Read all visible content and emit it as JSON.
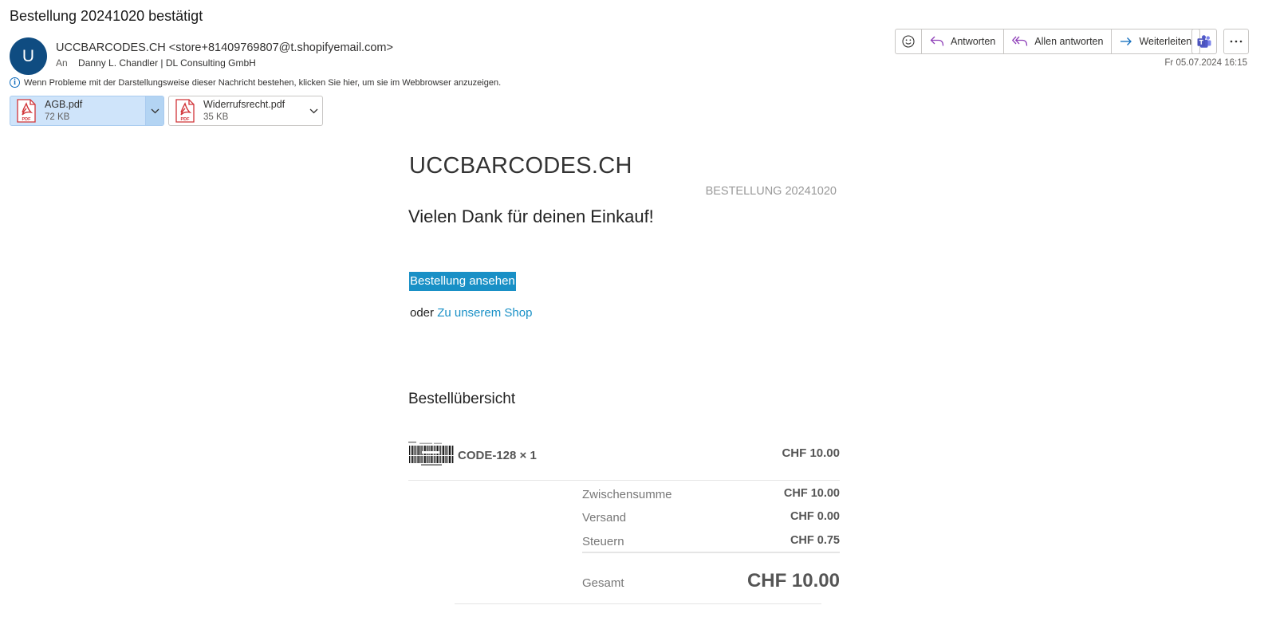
{
  "email": {
    "subject": "Bestellung 20241020 bestätigt",
    "avatar_letter": "U",
    "sender": "UCCBARCODES.CH <store+81409769807@t.shopifyemail.com>",
    "to_label": "An",
    "to_name": "Danny L. Chandler | DL Consulting GmbH",
    "info_text": "Wenn Probleme mit der Darstellungsweise dieser Nachricht bestehen, klicken Sie hier, um sie im Webbrowser anzuzeigen.",
    "date": "Fr 05.07.2024 16:15",
    "colors": {
      "avatar": "#0f4c81",
      "accent": "#1990c6",
      "reply_icon": "#8e3fb8",
      "forward_icon": "#0f6cbd"
    }
  },
  "attachments": [
    {
      "name": "AGB.pdf",
      "size": "72 KB",
      "icon": "pdf-icon"
    },
    {
      "name": "Widerrufsrecht.pdf",
      "size": "35 KB",
      "icon": "pdf-icon"
    }
  ],
  "toolbar": {
    "emoji_icon": "smiley-icon",
    "reply": "Antworten",
    "reply_all": "Allen antworten",
    "forward": "Weiterleiten",
    "teams_icon": "teams-icon",
    "more_icon": "more-icon"
  },
  "body": {
    "shop_title": "UCCBARCODES.CH",
    "order_number": "BESTELLUNG 20241020",
    "thanks": "Vielen Dank für deinen Einkauf!",
    "view_order": "Bestellung ansehen",
    "or_text": "oder",
    "shop_link": "Zu unserem Shop",
    "summary_heading": "Bestellübersicht",
    "item": {
      "name": "CODE-128 × 1",
      "price": "CHF 10.00",
      "image": "barcode-image"
    },
    "totals": [
      {
        "label": "Zwischensumme",
        "value": "CHF 10.00"
      },
      {
        "label": "Versand",
        "value": "CHF 0.00"
      },
      {
        "label": "Steuern",
        "value": "CHF 0.75"
      }
    ],
    "grand_label": "Gesamt",
    "grand_value": "CHF 10.00"
  }
}
